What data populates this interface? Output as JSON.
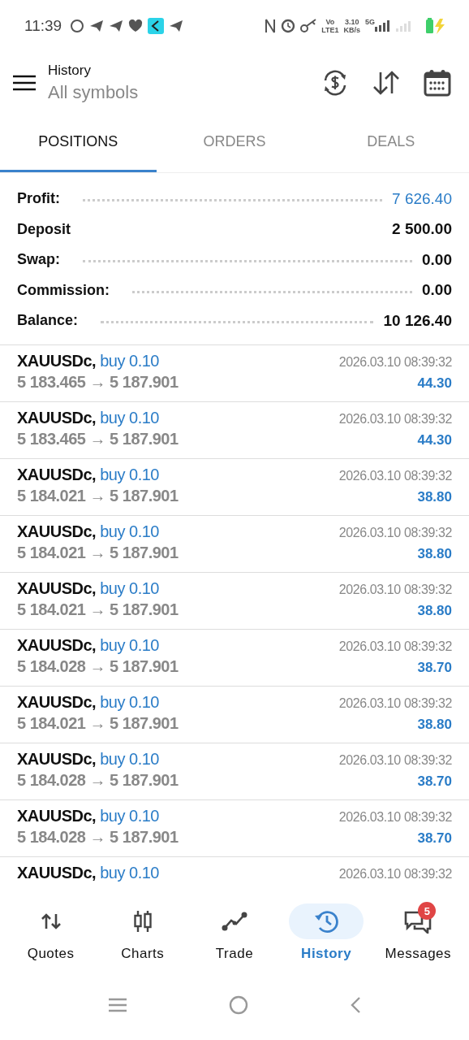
{
  "status_bar": {
    "time": "11:39",
    "volte": "Vo",
    "lte": "LTE1",
    "speed": "3.10",
    "speed_unit": "KB/s",
    "network": "5G"
  },
  "header": {
    "title": "History",
    "subtitle": "All symbols"
  },
  "tabs": [
    {
      "label": "POSITIONS",
      "selected": true
    },
    {
      "label": "ORDERS",
      "selected": false
    },
    {
      "label": "DEALS",
      "selected": false
    }
  ],
  "summary": [
    {
      "label": "Profit:",
      "value": "7 626.40",
      "dotted": true,
      "highlight": true
    },
    {
      "label": "Deposit",
      "value": "2 500.00",
      "dotted": false,
      "highlight": false
    },
    {
      "label": "Swap:",
      "value": "0.00",
      "dotted": true,
      "highlight": false
    },
    {
      "label": "Commission:",
      "value": "0.00",
      "dotted": true,
      "highlight": false
    },
    {
      "label": "Balance:",
      "value": "10 126.40",
      "dotted": true,
      "highlight": false
    }
  ],
  "positions": [
    {
      "symbol": "XAUUSDc,",
      "side": "buy 0.10",
      "time": "2026.03.10 08:39:32",
      "prices": "5 183.465 → 5 187.901",
      "profit": "44.30"
    },
    {
      "symbol": "XAUUSDc,",
      "side": "buy 0.10",
      "time": "2026.03.10 08:39:32",
      "prices": "5 183.465 → 5 187.901",
      "profit": "44.30"
    },
    {
      "symbol": "XAUUSDc,",
      "side": "buy 0.10",
      "time": "2026.03.10 08:39:32",
      "prices": "5 184.021 → 5 187.901",
      "profit": "38.80"
    },
    {
      "symbol": "XAUUSDc,",
      "side": "buy 0.10",
      "time": "2026.03.10 08:39:32",
      "prices": "5 184.021 → 5 187.901",
      "profit": "38.80"
    },
    {
      "symbol": "XAUUSDc,",
      "side": "buy 0.10",
      "time": "2026.03.10 08:39:32",
      "prices": "5 184.021 → 5 187.901",
      "profit": "38.80"
    },
    {
      "symbol": "XAUUSDc,",
      "side": "buy 0.10",
      "time": "2026.03.10 08:39:32",
      "prices": "5 184.028 → 5 187.901",
      "profit": "38.70"
    },
    {
      "symbol": "XAUUSDc,",
      "side": "buy 0.10",
      "time": "2026.03.10 08:39:32",
      "prices": "5 184.021 → 5 187.901",
      "profit": "38.80"
    },
    {
      "symbol": "XAUUSDc,",
      "side": "buy 0.10",
      "time": "2026.03.10 08:39:32",
      "prices": "5 184.028 → 5 187.901",
      "profit": "38.70"
    },
    {
      "symbol": "XAUUSDc,",
      "side": "buy 0.10",
      "time": "2026.03.10 08:39:32",
      "prices": "5 184.028 → 5 187.901",
      "profit": "38.70"
    },
    {
      "symbol": "XAUUSDc,",
      "side": "buy 0.10",
      "time": "2026.03.10 08:39:32"
    }
  ],
  "bottom_nav": [
    {
      "label": "Quotes",
      "kind": "quotes",
      "selected": false
    },
    {
      "label": "Charts",
      "kind": "charts",
      "selected": false
    },
    {
      "label": "Trade",
      "kind": "trade",
      "selected": false
    },
    {
      "label": "History",
      "kind": "history",
      "selected": true
    },
    {
      "label": "Messages",
      "kind": "messages",
      "selected": false,
      "badge": "5"
    }
  ]
}
